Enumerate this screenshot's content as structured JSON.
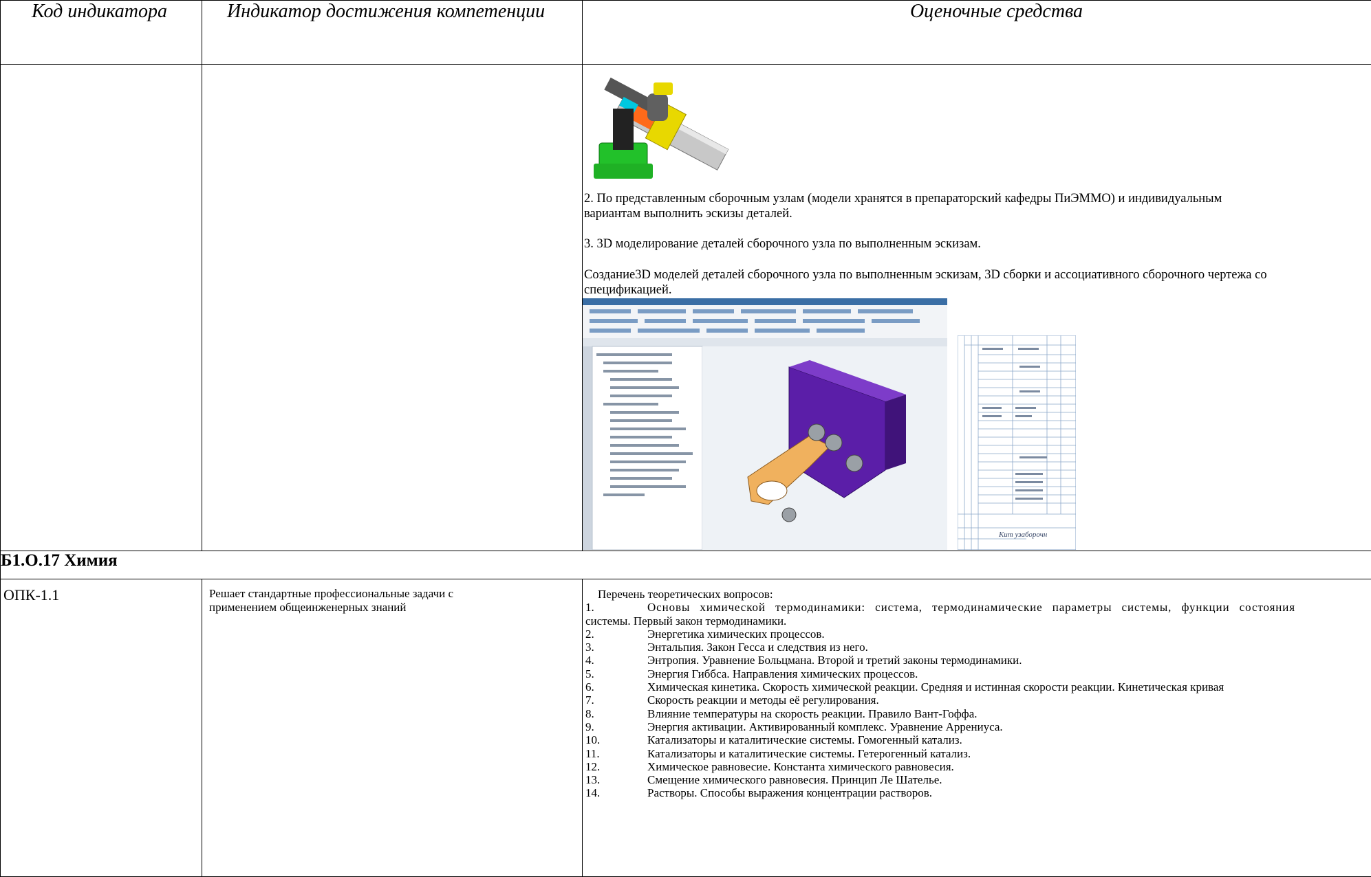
{
  "table": {
    "headers": [
      "Код индикатора",
      "Индикатор достижения компетенции",
      "Оценочные средства"
    ]
  },
  "row1": {
    "task2": [
      "2. По представленным сборочным узлам (модели хранятся в препараторский кафедры ПиЭММО) и индивидуальным",
      "вариантам выполнить эскизы деталей."
    ],
    "task3": "3. 3D моделирование деталей сборочного узла по выполненным эскизам.",
    "creation": [
      "Создание3D моделей деталей сборочного узла по выполненным эскизам, 3D сборки и ассоциативного сборочного чертежа со",
      "спецификацией."
    ],
    "spec_sheet_label": "Кит узаборочн"
  },
  "section": {
    "title": "Б1.О.17 Химия"
  },
  "row2": {
    "code": "ОПК-1.1",
    "indicator": [
      "Решает стандартные профессиональные задачи с",
      "применением общеинженерных знаний"
    ],
    "questions_intro": "Перечень теоретических вопросов:",
    "q1_first_line": "Основы химической термодинамики: система, термодинамические параметры системы, функции состояния",
    "q1_cont": "системы. Первый закон термодинамики.",
    "questions": [
      {
        "n": "1.",
        "text": ""
      },
      {
        "n": "2.",
        "text": "Энергетика химических процессов."
      },
      {
        "n": "3.",
        "text": "Энтальпия. Закон Гесса и следствия из него."
      },
      {
        "n": "4.",
        "text": "Энтропия. Уравнение Больцмана. Второй и третий законы термодинамики."
      },
      {
        "n": "5.",
        "text": "Энергия Гиббса. Направления химических процессов."
      },
      {
        "n": "6.",
        "text": "Химическая кинетика. Скорость химической реакции. Средняя и истинная скорости реакции. Кинетическая кривая"
      },
      {
        "n": "7.",
        "text": "Скорость реакции и методы её регулирования."
      },
      {
        "n": "8.",
        "text": "Влияние температуры на скорость реакции. Правило Вант-Гоффа."
      },
      {
        "n": "9.",
        "text": "Энергия активации. Активированный комплекс. Уравнение Аррениуса."
      },
      {
        "n": "10.",
        "text": "Катализаторы и каталитические системы. Гомогенный катализ."
      },
      {
        "n": "11.",
        "text": "Катализаторы и каталитические системы. Гетерогенный катализ."
      },
      {
        "n": "12.",
        "text": "Химическое равновесие. Константа химического равновесия."
      },
      {
        "n": "13.",
        "text": "Смещение химического равновесия. Принцип Ле Шателье."
      },
      {
        "n": "14.",
        "text": "Растворы. Способы выражения концентрации растворов."
      }
    ]
  }
}
